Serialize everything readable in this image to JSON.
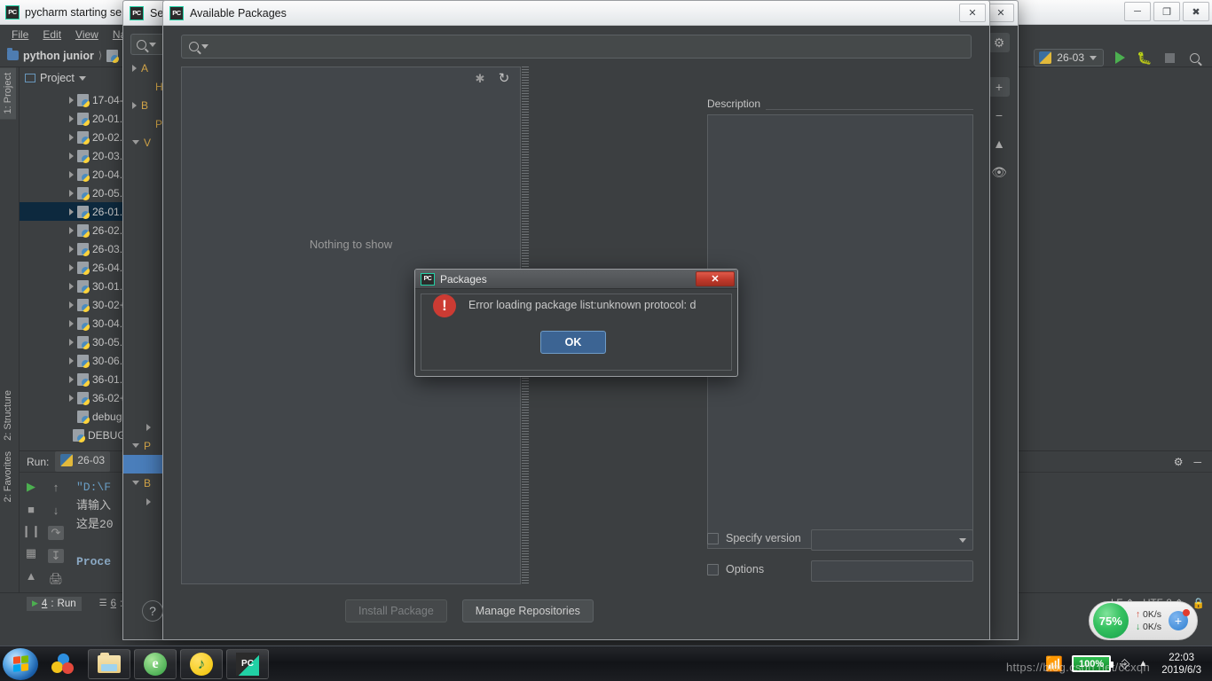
{
  "ide": {
    "title": "pycharm starting se",
    "icon": "pycharm-icon",
    "menu": [
      "File",
      "Edit",
      "View",
      "Navi"
    ],
    "breadcrumb": {
      "project": "python junior"
    },
    "project_panel": {
      "label": "Project"
    },
    "run_config": {
      "name": "26-03"
    },
    "left_strips": [
      {
        "label": "1: Project"
      },
      {
        "label": "2: Structure"
      },
      {
        "label": "2: Favorites"
      }
    ],
    "tree_items": [
      {
        "label": "17-04-",
        "expandable": true,
        "selected": false
      },
      {
        "label": "20-01.",
        "expandable": true,
        "selected": false
      },
      {
        "label": "20-02.",
        "expandable": true,
        "selected": false
      },
      {
        "label": "20-03.",
        "expandable": true,
        "selected": false
      },
      {
        "label": "20-04.",
        "expandable": true,
        "selected": false
      },
      {
        "label": "20-05.",
        "expandable": true,
        "selected": false
      },
      {
        "label": "26-01.",
        "expandable": true,
        "selected": true
      },
      {
        "label": "26-02.",
        "expandable": true,
        "selected": false
      },
      {
        "label": "26-03.",
        "expandable": true,
        "selected": false
      },
      {
        "label": "26-04.",
        "expandable": true,
        "selected": false
      },
      {
        "label": "30-01.",
        "expandable": true,
        "selected": false
      },
      {
        "label": "30-02+",
        "expandable": true,
        "selected": false
      },
      {
        "label": "30-04.",
        "expandable": true,
        "selected": false
      },
      {
        "label": "30-05.",
        "expandable": true,
        "selected": false
      },
      {
        "label": "30-06.",
        "expandable": true,
        "selected": false
      },
      {
        "label": "36-01.",
        "expandable": true,
        "selected": false
      },
      {
        "label": "36-02+",
        "expandable": true,
        "selected": false
      },
      {
        "label": "debug",
        "expandable": false,
        "selected": false
      },
      {
        "label": "DEBUG",
        "expandable": false,
        "selected": false
      }
    ],
    "run_window": {
      "label": "Run:",
      "config": "26-03",
      "console_lines": [
        "\"D:\\F",
        "请输入",
        "这是20",
        "",
        "Proce"
      ]
    },
    "bottom_tabs": [
      {
        "num": "4",
        "label": "Run",
        "active": true
      },
      {
        "num": "6",
        "label": "T",
        "active": false
      }
    ],
    "status": {
      "line_ending": "LF",
      "encoding": "UTF-8"
    }
  },
  "settings_dialog": {
    "title": "Se",
    "icon": "pycharm-icon",
    "close_label": "✕",
    "search_placeholder": "",
    "tree": [
      {
        "label": "A",
        "arrow": "right",
        "indent": false,
        "selected": false
      },
      {
        "label": "H",
        "arrow": "none",
        "indent": true,
        "selected": false
      },
      {
        "label": "B",
        "arrow": "right",
        "indent": false,
        "selected": false
      },
      {
        "label": "P",
        "arrow": "none",
        "indent": true,
        "selected": false
      },
      {
        "label": "V",
        "arrow": "down",
        "indent": false,
        "selected": false
      }
    ],
    "tree_lower": [
      {
        "label": "",
        "arrow": "right-small",
        "indent": true,
        "selected": false
      },
      {
        "label": "P",
        "arrow": "down",
        "indent": false,
        "selected": false
      },
      {
        "label": "",
        "arrow": "none",
        "indent": true,
        "selected": true
      },
      {
        "label": "B",
        "arrow": "down",
        "indent": false,
        "selected": false
      },
      {
        "label": "",
        "arrow": "right-small",
        "indent": true,
        "selected": false
      }
    ],
    "toolbar_icons": [
      "gear-icon",
      "plus-icon",
      "minus-icon",
      "up-arrow-icon",
      "eye-icon"
    ]
  },
  "packages_dialog": {
    "title": "Available Packages",
    "icon": "pycharm-icon",
    "close_label": "✕",
    "search": {
      "value": "",
      "icon": "search-icon"
    },
    "list": {
      "empty_text": "Nothing to show",
      "spinner_icon": "loading-spinner-icon",
      "refresh_icon": "refresh-icon"
    },
    "description": {
      "label": "Description",
      "content": ""
    },
    "specify_version": {
      "label": "Specify version",
      "checked": false,
      "value": ""
    },
    "options": {
      "label": "Options",
      "checked": false,
      "value": ""
    },
    "buttons": {
      "install": "Install Package",
      "manage": "Manage Repositories",
      "help": "?"
    }
  },
  "error_dialog": {
    "title": "Packages",
    "icon": "pycharm-icon",
    "close_label": "✕",
    "message": "Error loading package list:unknown protocol: d",
    "ok_label": "OK",
    "severity": "error",
    "severity_glyph": "!",
    "error_color": "#cc3b33"
  },
  "taskbar": {
    "start": "start-orb",
    "items": [
      {
        "name": "360-safe-icon",
        "glyph": ""
      },
      {
        "name": "file-explorer-icon",
        "glyph": ""
      },
      {
        "name": "360-browser-icon",
        "glyph": "e"
      },
      {
        "name": "qq-music-icon",
        "glyph": "♪"
      },
      {
        "name": "pycharm-taskbar-icon",
        "glyph": "PC"
      }
    ],
    "tray": {
      "wifi_icon": "wifi-icon",
      "battery": "100%",
      "power_icon": "power-plug-icon",
      "expand_icon": "show-hidden-icons-icon",
      "time": "22:03",
      "date": "2019/6/3"
    },
    "watermark": "https://blog.csdn.net/ccxqh"
  },
  "security_widget": {
    "percent": "75%",
    "upload": "0K/s",
    "download": "0K/s",
    "add_label": "+"
  }
}
